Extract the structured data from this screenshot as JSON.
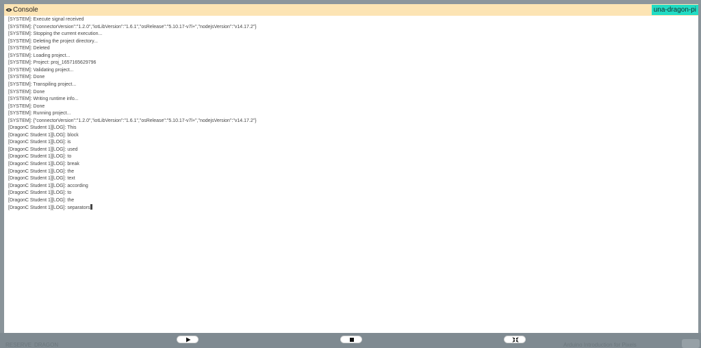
{
  "console": {
    "title": "Console",
    "device": "una-dragon-pi",
    "lines": [
      " [SYSTEM]: Execute signal received",
      " [SYSTEM]: {\"connectorVersion\":\"1.2.0\",\"iotLibVersion\":\"1.6.1\",\"osRelease\":\"5.10.17-v7l+\",\"nodejsVersion\":\"v14.17.2\"}",
      " [SYSTEM]: Stopping the current execution...",
      " [SYSTEM]: Deleting the project directory...",
      " [SYSTEM]: Deleted",
      " [SYSTEM]: Loading project...",
      " [SYSTEM]: Project: proj_1657165629796",
      " [SYSTEM]: Validating project...",
      " [SYSTEM]: Done",
      " [SYSTEM]: Transpiling project...",
      " [SYSTEM]: Done",
      " [SYSTEM]: Writing runtime info...",
      " [SYSTEM]: Done",
      " [SYSTEM]: Running project...",
      " [SYSTEM]: {\"connectorVersion\":\"1.2.0\",\"iotLibVersion\":\"1.6.1\",\"osRelease\":\"5.10.17-v7l+\",\"nodejsVersion\":\"v14.17.2\"}",
      "[DragonC Student 1][LOG]: This",
      "[DragonC Student 1][LOG]: block",
      "[DragonC Student 1][LOG]: is",
      "[DragonC Student 1][LOG]: used",
      "[DragonC Student 1][LOG]: to",
      "[DragonC Student 1][LOG]: break",
      "[DragonC Student 1][LOG]: the",
      "[DragonC Student 1][LOG]: text",
      "[DragonC Student 1][LOG]: according",
      "[DragonC Student 1][LOG]: to",
      "[DragonC Student 1][LOG]: the",
      "[DragonC Student 1][LOG]: separators"
    ]
  },
  "controls": {
    "play_icon": "play-icon",
    "stop_icon": "stop-icon",
    "collapse_icon": "collapse-icon"
  },
  "background": {
    "left_text": "RESERVE",
    "middle_text": "DRAGON",
    "right_text": "Arduino Introduction for Pixels"
  },
  "colors": {
    "header": "#fce4b4",
    "badge": "#22dcc4",
    "backdrop": "#7f8a91"
  }
}
